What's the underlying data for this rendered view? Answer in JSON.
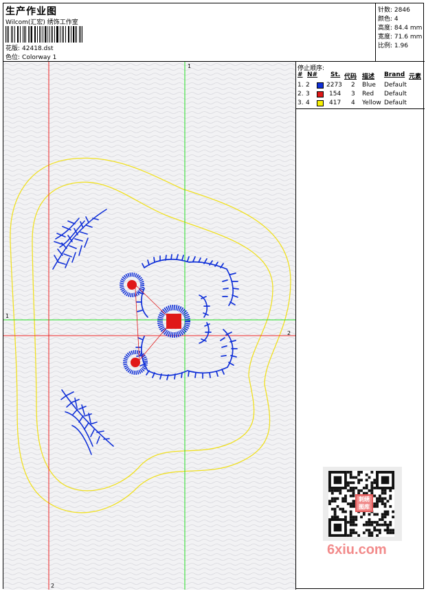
{
  "header": {
    "title": "生产作业图",
    "company": "Wilcom(汇宏) 绣饰工作室",
    "design_label": "花版:",
    "design_value": "42418.dst",
    "colorway_label": "色位:",
    "colorway_value": "Colorway 1"
  },
  "stats": [
    {
      "label": "针数:",
      "value": "2846"
    },
    {
      "label": "颜色:",
      "value": "4"
    },
    {
      "label": "高度:",
      "value": "84.4 mm"
    },
    {
      "label": "宽度:",
      "value": "71.6 mm"
    },
    {
      "label": "比例:",
      "value": "1.96"
    }
  ],
  "canvas": {
    "marker_top_green": "1",
    "marker_left_green": "1",
    "marker_right_red": "2",
    "marker_bottom_red": "2"
  },
  "stop_sequence": {
    "title": "停止顺序:",
    "columns": {
      "hash": "#",
      "n": "N#",
      "st": "St.",
      "code": "代码",
      "desc": "描述",
      "brand": "Brand",
      "elem": "元素"
    },
    "rows": [
      {
        "index": "1.",
        "n": "2",
        "color": "#1030d8",
        "st": "2273",
        "code": "2",
        "desc": "Blue",
        "brand": "Default"
      },
      {
        "index": "2.",
        "n": "3",
        "color": "#e01818",
        "st": "154",
        "code": "3",
        "desc": "Red",
        "brand": "Default"
      },
      {
        "index": "3.",
        "n": "4",
        "color": "#f8f000",
        "st": "417",
        "code": "4",
        "desc": "Yellow",
        "brand": "Default"
      }
    ]
  },
  "watermark": {
    "seal_text": "刺绣图库",
    "site": "6xiu.com"
  },
  "colors": {
    "blue_thread": "#1030d8",
    "red_thread": "#e01818",
    "yellow_thread": "#f0e020",
    "guide_green": "#22dd22",
    "guide_red": "#ee2222"
  }
}
